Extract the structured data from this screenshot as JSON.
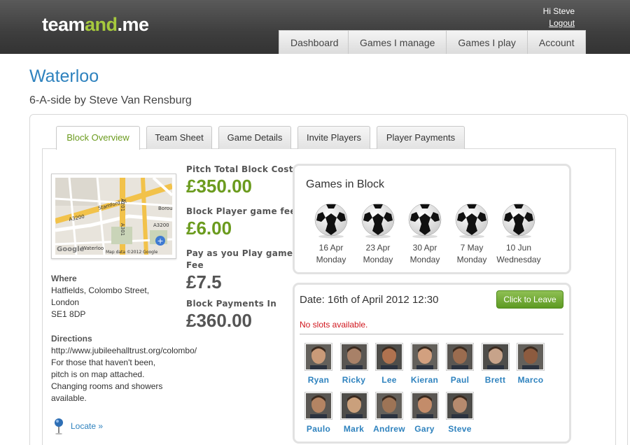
{
  "header": {
    "logo_a": "team",
    "logo_b": "and",
    "logo_c": ".me",
    "greeting": "Hi Steve",
    "logout": "Logout",
    "nav": [
      "Dashboard",
      "Games I manage",
      "Games I play",
      "Account"
    ]
  },
  "page": {
    "title": "Waterloo",
    "subtitle": "6-A-side by Steve Van Rensburg"
  },
  "tabs": [
    "Block Overview",
    "Team Sheet",
    "Game Details",
    "Invite Players",
    "Player Payments"
  ],
  "map": {
    "labels": [
      "Stamford St",
      "A3200",
      "A3200",
      "Borou",
      "A201",
      "A301",
      "Waterloo"
    ],
    "credit": "Map data ©2012 Google",
    "google": "Google"
  },
  "location": {
    "where_label": "Where",
    "where_lines": [
      "Hatfields, Colombo Street,",
      "London",
      "SE1 8DP"
    ],
    "directions_label": "Directions",
    "directions_lines": [
      "http://www.jubileehalltrust.org/colombo/",
      "For those that haven't been,",
      "pitch is on map attached.",
      "Changing rooms and showers",
      "available."
    ],
    "locate": "Locate »"
  },
  "costs": {
    "pitch_label": "Pitch Total Block Cost",
    "pitch_value": "£350.00",
    "fee_label": "Block Player game fee",
    "fee_value": "£6.00",
    "payg_label_1": "Pay as you Play game",
    "payg_label_2": "Fee",
    "payg_value": "£7.5",
    "payments_label": "Block Payments In",
    "payments_value": "£360.00"
  },
  "games": {
    "title": "Games in Block",
    "items": [
      {
        "date": "16 Apr",
        "day": "Monday"
      },
      {
        "date": "23 Apr",
        "day": "Monday"
      },
      {
        "date": "30 Apr",
        "day": "Monday"
      },
      {
        "date": "7 May",
        "day": "Monday"
      },
      {
        "date": "10 Jun",
        "day": "Wednesday"
      }
    ]
  },
  "game_detail": {
    "date": "Date: 16th of April 2012 12:30",
    "leave_button": "Click to Leave",
    "slots": "No slots available.",
    "players": [
      "Ryan",
      "Ricky",
      "Lee",
      "Kieran",
      "Paul",
      "Brett",
      "Marco",
      "Paulo",
      "Mark",
      "Andrew",
      "Gary",
      "Steve"
    ]
  },
  "colors": {
    "accent_blue": "#2e82be",
    "accent_green": "#6b9b1e",
    "alert_red": "#d0161d"
  }
}
